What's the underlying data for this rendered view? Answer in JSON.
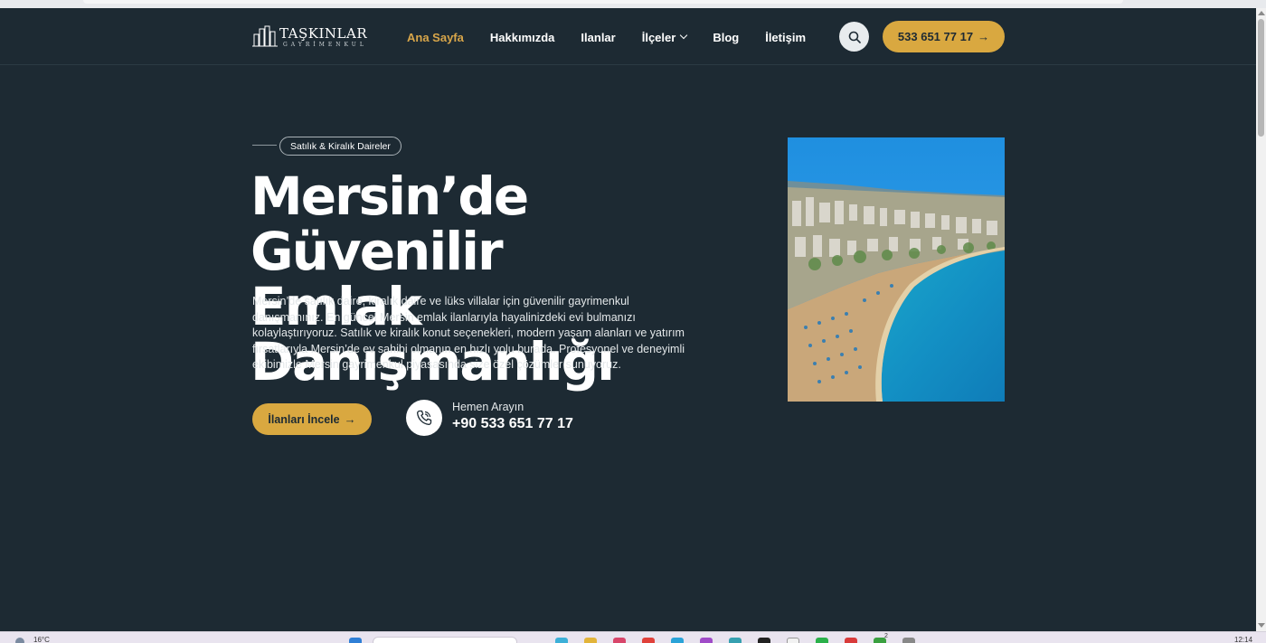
{
  "header": {
    "logo": {
      "brand": "TAŞKINLAR",
      "sub": "GAYRİMENKUL"
    },
    "nav": [
      {
        "label": "Ana Sayfa",
        "active": true
      },
      {
        "label": "Hakkımızda"
      },
      {
        "label": "Ilanlar"
      },
      {
        "label": "İlçeler",
        "dropdown": true
      },
      {
        "label": "Blog"
      },
      {
        "label": "İletişim"
      }
    ],
    "search_icon": "search-icon",
    "phone_button": "533 651 77 17",
    "arrow": "→"
  },
  "hero": {
    "tag": "Satılık & Kiralık Daireler",
    "title_line1": "Mersin’de Güvenilir",
    "title_line2": "Emlak Danışmanlığı",
    "description": "Mersin’de satılık daire, kiralık daire ve lüks villalar için güvenilir gayrimenkul danışmanınız. En güncel Mersin emlak ilanlarıyla hayalinizdeki evi bulmanızı kolaylaştırıyoruz. Satılık ve kiralık konut seçenekleri, modern yaşam alanları ve yatırım fırsatlarıyla Mersin’de ev sahibi olmanın en hızlı yolu burada. Profesyonel ve deneyimli ekibimizle Mersin gayrimenkul piyasasında size özel çözümler sunuyoruz.",
    "cta": "İlanları İncele",
    "call_label": "Hemen Arayın",
    "call_number": "+90 533 651 77 17",
    "image": "coastal-city-aerial-photo"
  },
  "taskbar": {
    "temperature": "16°C",
    "time": "12:14",
    "badge": "2"
  },
  "colors": {
    "background": "#1d2a33",
    "accent": "#d9a840",
    "active_nav": "#d8a64a"
  }
}
